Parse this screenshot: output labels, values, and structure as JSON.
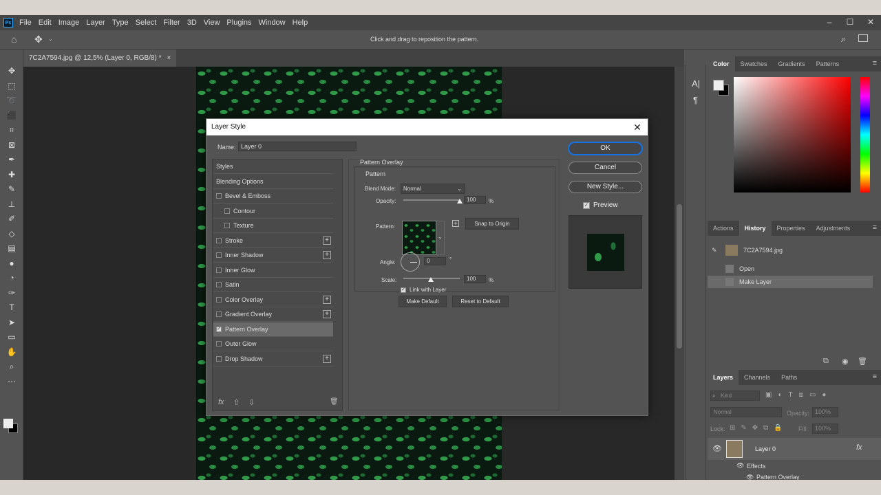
{
  "app": {
    "logo": "Ps",
    "menus": [
      "File",
      "Edit",
      "Image",
      "Layer",
      "Type",
      "Select",
      "Filter",
      "3D",
      "View",
      "Plugins",
      "Window",
      "Help"
    ],
    "window_controls": [
      "–",
      "☐",
      "✕"
    ],
    "options_hint": "Click and drag to reposition the pattern.",
    "document_tab": "7C2A7594.jpg @ 12,5% (Layer 0, RGB/8) *",
    "document_tab_close": "×"
  },
  "dialog": {
    "title": "Layer Style",
    "close": "✕",
    "name_label": "Name:",
    "name_value": "Layer 0",
    "style_items": [
      {
        "label": "Styles",
        "checkbox": false,
        "checked": false,
        "plus": false,
        "indent": 0,
        "active": false
      },
      {
        "label": "Blending Options",
        "checkbox": false,
        "checked": false,
        "plus": false,
        "indent": 0,
        "active": false
      },
      {
        "label": "Bevel & Emboss",
        "checkbox": true,
        "checked": false,
        "plus": false,
        "indent": 0,
        "active": false
      },
      {
        "label": "Contour",
        "checkbox": true,
        "checked": false,
        "plus": false,
        "indent": 1,
        "active": false
      },
      {
        "label": "Texture",
        "checkbox": true,
        "checked": false,
        "plus": false,
        "indent": 1,
        "active": false
      },
      {
        "label": "Stroke",
        "checkbox": true,
        "checked": false,
        "plus": true,
        "indent": 0,
        "active": false
      },
      {
        "label": "Inner Shadow",
        "checkbox": true,
        "checked": false,
        "plus": true,
        "indent": 0,
        "active": false
      },
      {
        "label": "Inner Glow",
        "checkbox": true,
        "checked": false,
        "plus": false,
        "indent": 0,
        "active": false
      },
      {
        "label": "Satin",
        "checkbox": true,
        "checked": false,
        "plus": false,
        "indent": 0,
        "active": false
      },
      {
        "label": "Color Overlay",
        "checkbox": true,
        "checked": false,
        "plus": true,
        "indent": 0,
        "active": false
      },
      {
        "label": "Gradient Overlay",
        "checkbox": true,
        "checked": false,
        "plus": true,
        "indent": 0,
        "active": false
      },
      {
        "label": "Pattern Overlay",
        "checkbox": true,
        "checked": true,
        "plus": false,
        "indent": 0,
        "active": true
      },
      {
        "label": "Outer Glow",
        "checkbox": true,
        "checked": false,
        "plus": false,
        "indent": 0,
        "active": false
      },
      {
        "label": "Drop Shadow",
        "checkbox": true,
        "checked": false,
        "plus": true,
        "indent": 0,
        "active": false
      }
    ],
    "list_footer": {
      "fx": "fx",
      "up": "⇧",
      "down": "⇩",
      "trash": "🗑"
    },
    "section_title": "Pattern Overlay",
    "subsection_title": "Pattern",
    "blend_mode_label": "Blend Mode:",
    "blend_mode_value": "Normal",
    "opacity_label": "Opacity:",
    "opacity_value": "100",
    "opacity_unit": "%",
    "opacity_fraction": 1.0,
    "pattern_label": "Pattern:",
    "snap_button": "Snap to Origin",
    "angle_label": "Angle:",
    "angle_value": "0",
    "angle_unit": "°",
    "scale_label": "Scale:",
    "scale_value": "100",
    "scale_unit": "%",
    "link_label": "Link with Layer",
    "make_default": "Make Default",
    "reset_default": "Reset to Default",
    "ok": "OK",
    "cancel": "Cancel",
    "new_style": "New Style...",
    "preview_label": "Preview"
  },
  "color_panel": {
    "tabs": [
      "Color",
      "Swatches",
      "Gradients",
      "Patterns"
    ],
    "active_tab": "Color",
    "accent": "#ff0000"
  },
  "history_panel": {
    "tabs": [
      "Actions",
      "History",
      "Properties",
      "Adjustments"
    ],
    "active_tab": "History",
    "snapshot": "7C2A7594.jpg",
    "rows": [
      "Open",
      "Make Layer"
    ]
  },
  "layers_panel": {
    "tabs": [
      "Layers",
      "Channels",
      "Paths"
    ],
    "active_tab": "Layers",
    "kind_placeholder": "Kind",
    "blend_mode": "Normal",
    "opacity_label": "Opacity:",
    "opacity_value": "100%",
    "lock_label": "Lock:",
    "fill_label": "Fill:",
    "fill_value": "100%",
    "layer_name": "Layer 0",
    "fx_badge": "fx",
    "effects_label": "Effects",
    "effect_item": "Pattern Overlay"
  },
  "icons": {
    "tools": [
      "move-icon",
      "marquee-icon",
      "lasso-icon",
      "object-select-icon",
      "crop-icon",
      "frame-icon",
      "eyedropper-icon",
      "healing-icon",
      "brush-icon",
      "stamp-icon",
      "history-brush-icon",
      "eraser-icon",
      "gradient-icon",
      "blur-icon",
      "dodge-icon",
      "pen-icon",
      "type-icon",
      "path-select-icon",
      "rectangle-icon",
      "hand-icon",
      "zoom-icon",
      "more-icon"
    ]
  }
}
